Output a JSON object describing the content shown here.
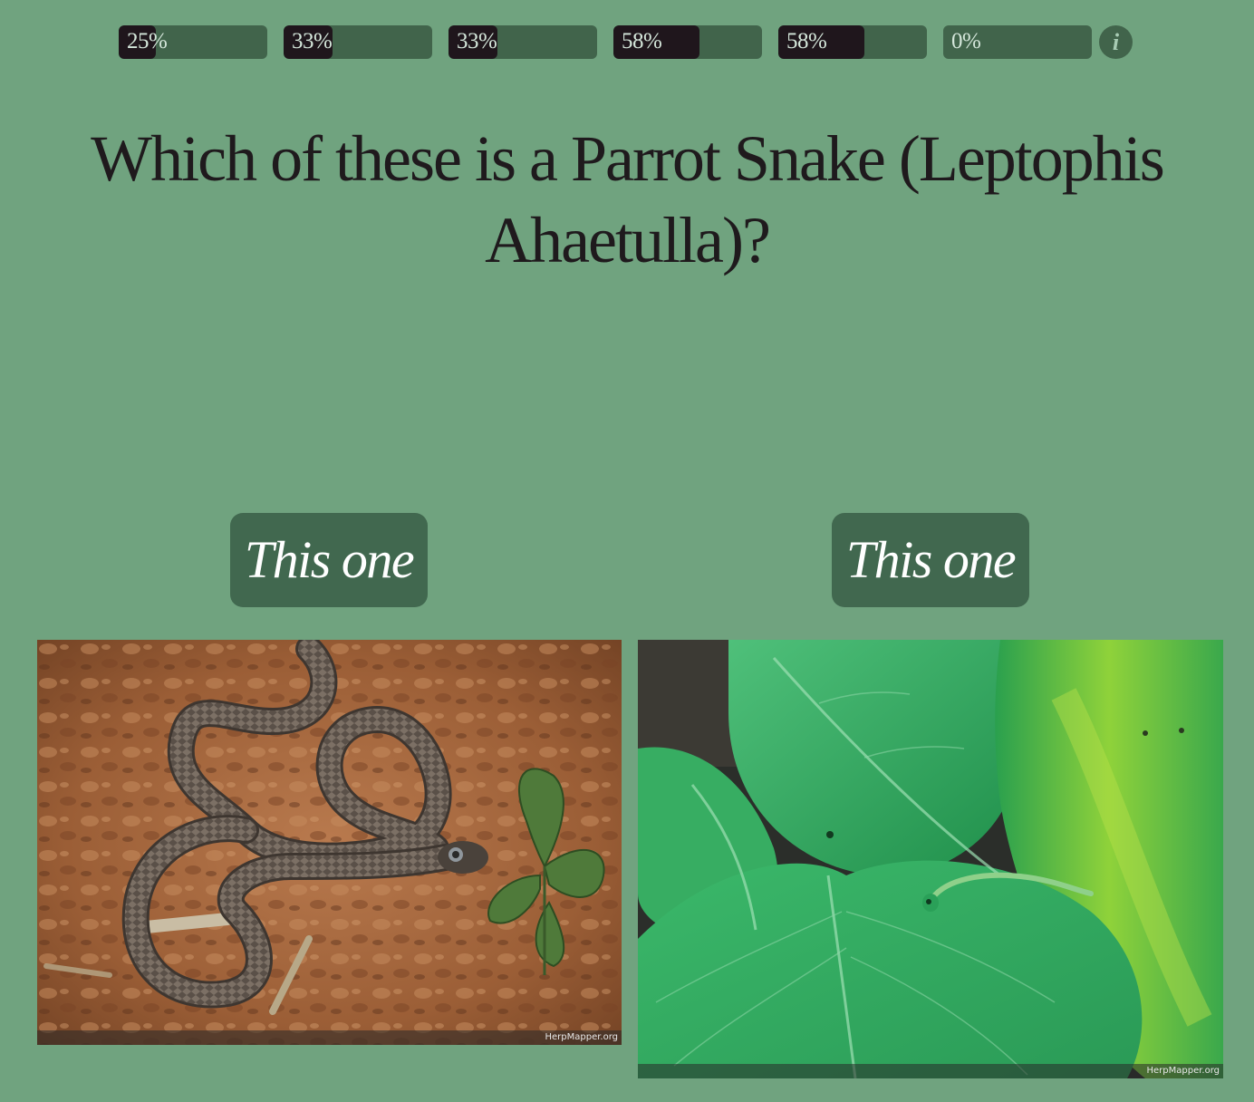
{
  "progress": [
    {
      "label": "25%",
      "value": 0.25
    },
    {
      "label": "33%",
      "value": 0.33
    },
    {
      "label": "33%",
      "value": 0.33
    },
    {
      "label": "58%",
      "value": 0.58
    },
    {
      "label": "58%",
      "value": 0.58
    },
    {
      "label": "0%",
      "value": 0.0
    }
  ],
  "info_icon": {
    "glyph": "i",
    "icon": "info-icon"
  },
  "question": {
    "line1": "Which of these is a Parrot Snake (Leptophis",
    "line2": "Ahaetulla)?"
  },
  "choices": [
    {
      "label": "This one",
      "credit": "HerpMapper.org"
    },
    {
      "label": "This one",
      "credit": "HerpMapper.org"
    }
  ],
  "colors": {
    "background": "#70a37f",
    "bar_track": "#41644b",
    "bar_fill": "#1f161c",
    "button": "#41684f",
    "text": "#1f1a1d"
  }
}
